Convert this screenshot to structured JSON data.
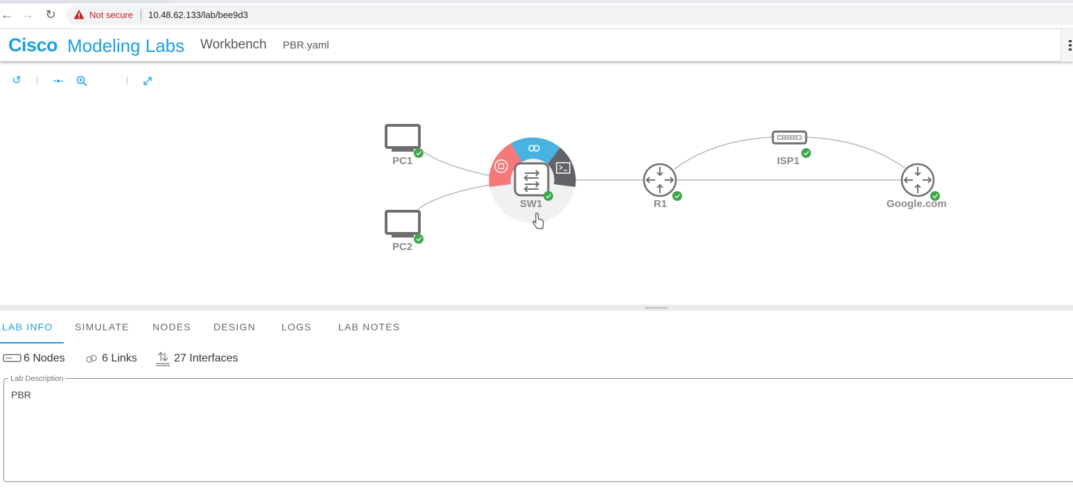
{
  "browser": {
    "not_secure": "Not secure",
    "url": "10.48.62.133/lab/bee9d3"
  },
  "header": {
    "brand_cisco": "Cisco",
    "brand_rest": "Modeling Labs",
    "workbench": "Workbench",
    "filename": "PBR.yaml"
  },
  "toolbar": {
    "icons": [
      "refresh-icon",
      "center-icon",
      "zoom-in-icon",
      "expand-icon"
    ]
  },
  "topology": {
    "nodes": [
      {
        "label": "PC1",
        "type": "desktop",
        "status": "running"
      },
      {
        "label": "PC2",
        "type": "desktop",
        "status": "running"
      },
      {
        "label": "SW1",
        "type": "switch",
        "status": "running",
        "selected": true
      },
      {
        "label": "R1",
        "type": "router",
        "status": "running"
      },
      {
        "label": "ISP1",
        "type": "unmanaged-switch",
        "status": "running"
      },
      {
        "label": "Google.com",
        "type": "router",
        "status": "running"
      }
    ],
    "context_menu": [
      "stop-icon",
      "link-icon",
      "console-icon"
    ],
    "colors": {
      "stop": "#f47a7a",
      "link": "#48b3e0",
      "console": "#616368",
      "status_ok": "#3fa64a"
    }
  },
  "tabs": [
    {
      "label": "LAB INFO",
      "active": true
    },
    {
      "label": "SIMULATE",
      "active": false
    },
    {
      "label": "NODES",
      "active": false
    },
    {
      "label": "DESIGN",
      "active": false
    },
    {
      "label": "LOGS",
      "active": false
    },
    {
      "label": "LAB NOTES",
      "active": false
    }
  ],
  "stats": {
    "nodes": "6 Nodes",
    "links": "6 Links",
    "interfaces": "27 Interfaces"
  },
  "description": {
    "legend": "Lab Description",
    "text": "PBR"
  }
}
